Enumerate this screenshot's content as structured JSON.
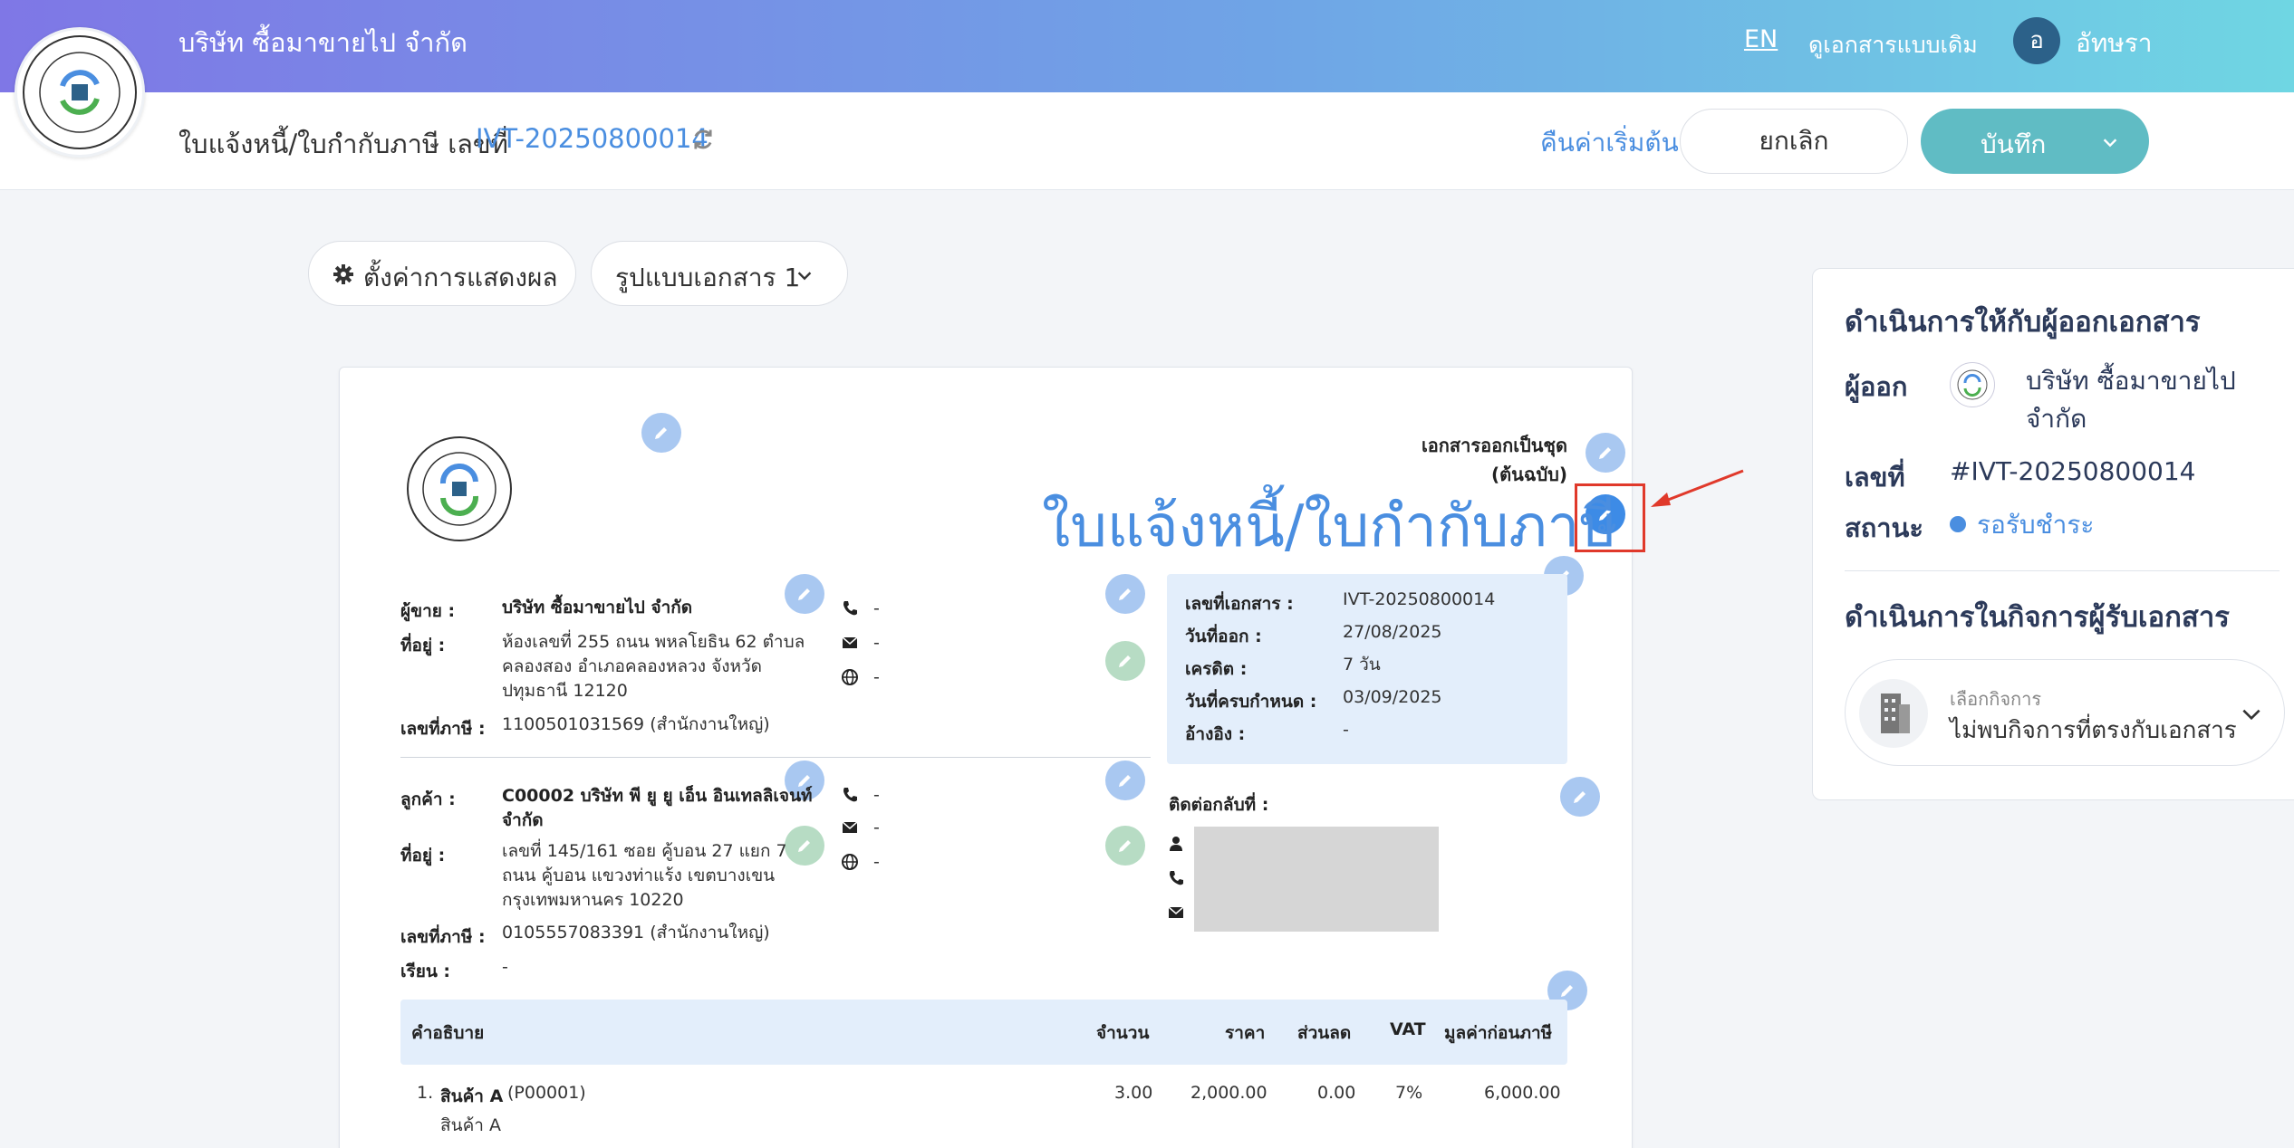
{
  "header": {
    "company_name": "บริษัท ซื้อมาขายไป จำกัด",
    "lang": "EN",
    "old_doc_link": "ดูเอกสารแบบเดิม",
    "avatar_initial": "อ",
    "user_name": "อัทษรา"
  },
  "subbar": {
    "doc_title": "ใบแจ้งหนี้/ใบกำกับภาษี เลขที่",
    "doc_number": "IVT-20250800014",
    "reset": "คืนค่าเริ่มต้น",
    "cancel": "ยกเลิก",
    "save": "บันทึก"
  },
  "toolbar": {
    "settings": "ตั้งค่าการแสดงผล",
    "format": "รูปแบบเอกสาร 1"
  },
  "document": {
    "set_note_line1": "เอกสารออกเป็นชุด",
    "set_note_line2": "(ต้นฉบับ)",
    "title": "ใบแจ้งหนี้/ใบกำกับภาษี",
    "seller": {
      "seller_label": "ผู้ขาย :",
      "seller_name": "บริษัท ซื้อมาขายไป จำกัด",
      "address_label": "ที่อยู่ :",
      "address_l1": "ห้องเลขที่ 255 ถนน พหลโยธิน 62 ตำบล",
      "address_l2": "คลองสอง อำเภอคลองหลวง จังหวัด",
      "address_l3": "ปทุมธานี 12120",
      "tax_label": "เลขที่ภาษี :",
      "tax_id": "1100501031569 (สำนักงานใหญ่)",
      "phone": "-",
      "email": "-",
      "web": "-"
    },
    "customer": {
      "customer_label": "ลูกค้า :",
      "customer_name_l1": "C00002 บริษัท พี ยู ยู เอ็น อินเทลลิเจนท์",
      "customer_name_l2": "จำกัด",
      "address_label": "ที่อยู่ :",
      "address_l1": "เลขที่ 145/161     ซอย คู้บอน 27 แยก 7",
      "address_l2": "ถนน คู้บอน  แขวงท่าแร้ง เขตบางเขน",
      "address_l3": "กรุงเทพมหานคร 10220",
      "tax_label": "เลขที่ภาษี :",
      "tax_id": "0105557083391 (สำนักงานใหญ่)",
      "attn_label": "เรียน :",
      "attn": "-",
      "phone": "-",
      "email": "-",
      "web": "-"
    },
    "info": {
      "doc_no_label": "เลขที่เอกสาร :",
      "doc_no": "IVT-20250800014",
      "issue_label": "วันที่ออก :",
      "issue_date": "27/08/2025",
      "credit_label": "เครดิต :",
      "credit": "7 วัน",
      "due_label": "วันที่ครบกำหนด :",
      "due_date": "03/09/2025",
      "ref_label": "อ้างอิง :",
      "ref": "-"
    },
    "contact_label": "ติดต่อกลับที่ :",
    "table": {
      "headers": {
        "desc": "คำอธิบาย",
        "qty": "จำนวน",
        "price": "ราคา",
        "discount": "ส่วนลด",
        "vat": "VAT",
        "amount": "มูลค่าก่อนภาษี"
      },
      "rows": [
        {
          "no": "1.",
          "name": "สินค้า A",
          "code": "(P00001)",
          "sub": "สินค้า A",
          "qty": "3.00",
          "price": "2,000.00",
          "discount": "0.00",
          "vat": "7%",
          "amount": "6,000.00"
        }
      ]
    }
  },
  "panel": {
    "issuer_heading": "ดำเนินการให้กับผู้ออกเอกสาร",
    "issuer_label": "ผู้ออก",
    "issuer_name_l1": "บริษัท ซื้อมาขายไป",
    "issuer_name_l2": "จำกัด",
    "number_label": "เลขที่",
    "number": "#IVT-20250800014",
    "status_label": "สถานะ",
    "status": "รอรับชำระ",
    "recipient_heading": "ดำเนินการในกิจการผู้รับเอกสาร",
    "biz_select_label": "เลือกกิจการ",
    "biz_select_value": "ไม่พบกิจการที่ตรงกับเอกสาร"
  },
  "colors": {
    "accent": "#4a8ee0",
    "save_button": "#60bcc4",
    "highlight_box": "#e0392b"
  }
}
